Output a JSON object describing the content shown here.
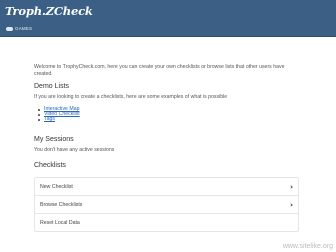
{
  "header": {
    "logo": "Troph.ZCheck",
    "nav_games": "GAMES",
    "nav_icon": "gamepad-icon"
  },
  "intro": "Welcome to TrophyCheck.com, here you can create your own checklists or browse lists that other users have created.",
  "demo": {
    "heading": "Demo Lists",
    "text": "If you are looking to create a checklists, here are some examples of what is possible",
    "links": [
      "Interactive Map",
      "Video Checklist",
      "Tags"
    ]
  },
  "sessions": {
    "heading": "My Sessions",
    "text": "You don't have any active sessions"
  },
  "checklists": {
    "heading": "Checklists",
    "items": [
      {
        "label": "New Checklist",
        "chevron": "›",
        "icon": "chevron-right-icon"
      },
      {
        "label": "Browse Checklists",
        "chevron": "›",
        "icon": "chevron-right-icon"
      },
      {
        "label": "Reset Local Data",
        "chevron": "",
        "icon": ""
      }
    ]
  },
  "watermark": "www.sitelike.org",
  "colors": {
    "header_bg": "#3c5f85",
    "link": "#2a66b8",
    "page_bg": "#ffffff"
  }
}
